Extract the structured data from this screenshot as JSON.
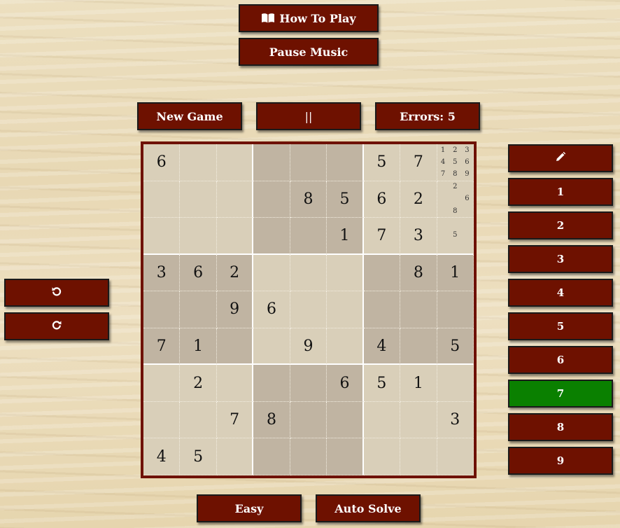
{
  "header": {
    "how_to_play_label": "How To Play",
    "pause_music_label": "Pause Music"
  },
  "controls": {
    "new_game_label": "New Game",
    "pause_label": "||",
    "errors_label": "Errors: 5"
  },
  "footer": {
    "difficulty_label": "Easy",
    "auto_solve_label": "Auto Solve"
  },
  "side": {
    "undo_icon": "undo-icon",
    "redo_icon": "redo-icon"
  },
  "numpad": {
    "pencil_icon": "pencil-icon",
    "numbers": [
      "1",
      "2",
      "3",
      "4",
      "5",
      "6",
      "7",
      "8",
      "9"
    ],
    "selected": "7",
    "selected_color": "#0a8000"
  },
  "colors": {
    "button_bg": "#6e1100",
    "board_light": "#d9cfb9",
    "board_dark": "#c0b4a2"
  },
  "board": [
    [
      "6",
      "",
      "",
      "",
      "",
      "",
      "5",
      "7",
      ""
    ],
    [
      "",
      "",
      "",
      "",
      "8",
      "5",
      "6",
      "2",
      ""
    ],
    [
      "",
      "",
      "",
      "",
      "",
      "1",
      "7",
      "3",
      ""
    ],
    [
      "3",
      "6",
      "2",
      "",
      "",
      "",
      "",
      "8",
      "1"
    ],
    [
      "",
      "",
      "9",
      "6",
      "",
      "",
      "",
      "",
      ""
    ],
    [
      "7",
      "1",
      "",
      "",
      "9",
      "",
      "4",
      "",
      "5"
    ],
    [
      "",
      "2",
      "",
      "",
      "",
      "6",
      "5",
      "1",
      ""
    ],
    [
      "",
      "",
      "7",
      "8",
      "",
      "",
      "",
      "",
      "3"
    ],
    [
      "4",
      "5",
      "",
      "",
      "",
      "",
      "",
      "",
      ""
    ]
  ],
  "notes": {
    "0-8": [
      "1",
      "2",
      "3",
      "4",
      "5",
      "6",
      "7",
      "8",
      "9"
    ],
    "1-8": [
      "",
      "2",
      "",
      "",
      "",
      "6",
      "",
      "8",
      ""
    ],
    "2-8": [
      "",
      "",
      "",
      "",
      "5",
      "",
      "",
      "",
      ""
    ]
  }
}
